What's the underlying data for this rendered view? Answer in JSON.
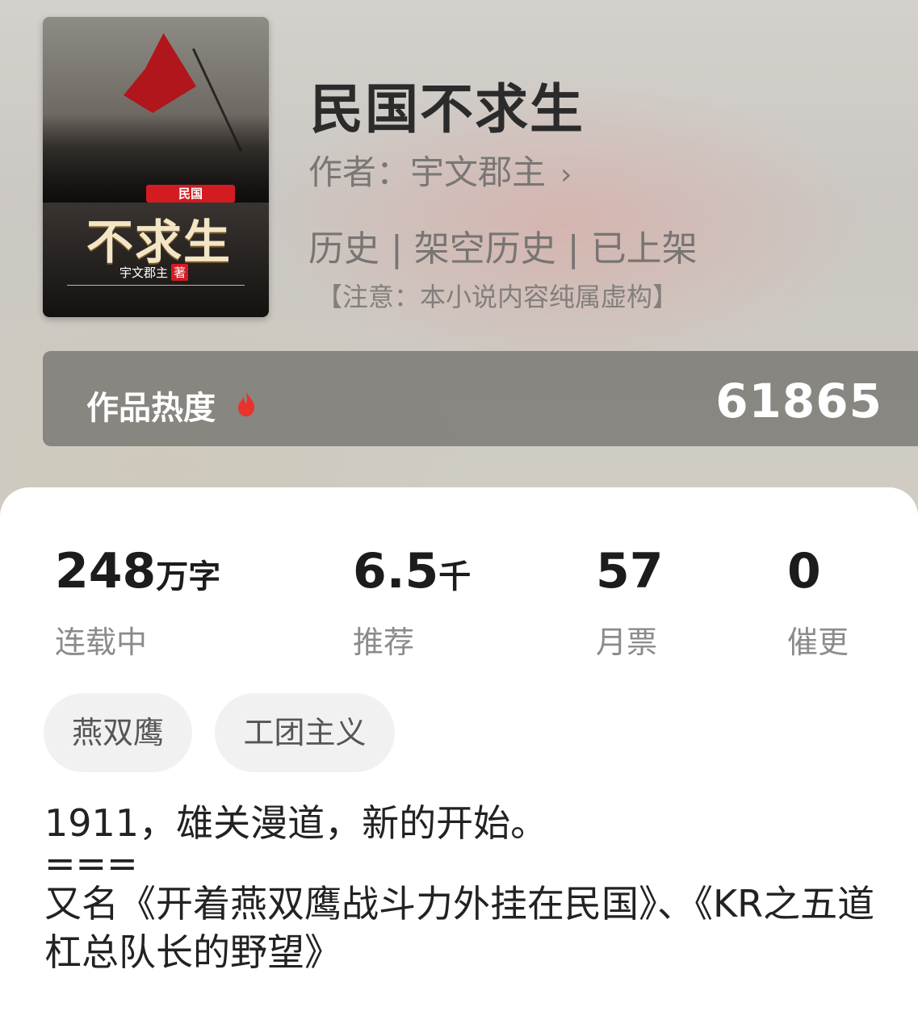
{
  "book": {
    "title": "民国不求生",
    "author_label": "作者：",
    "author": "宇文郡主",
    "author_chevron": "›",
    "categories": "历史 | 架空历史 | 已上架",
    "notice": "【注意：本小说内容纯属虚构】"
  },
  "cover": {
    "badge": "民国",
    "big_title": "不求生",
    "author": "宇文郡主",
    "author_suffix": "著"
  },
  "heat": {
    "label": "作品热度",
    "value": "61865",
    "icon": "flame-icon",
    "icon_color": "#e8332f"
  },
  "stats": [
    {
      "value": "248",
      "unit": "万字",
      "label": "连载中"
    },
    {
      "value": "6.5",
      "unit": "千",
      "label": "推荐"
    },
    {
      "value": "57",
      "unit": "",
      "label": "月票"
    },
    {
      "value": "0",
      "unit": "",
      "label": "催更"
    }
  ],
  "tags": [
    "燕双鹰",
    "工团主义"
  ],
  "description": {
    "line1": "1911，雄关漫道，新的开始。",
    "line2": "===",
    "line3": "又名《开着燕双鹰战斗力外挂在民国》、《KR之五道杠总队长的野望》"
  }
}
